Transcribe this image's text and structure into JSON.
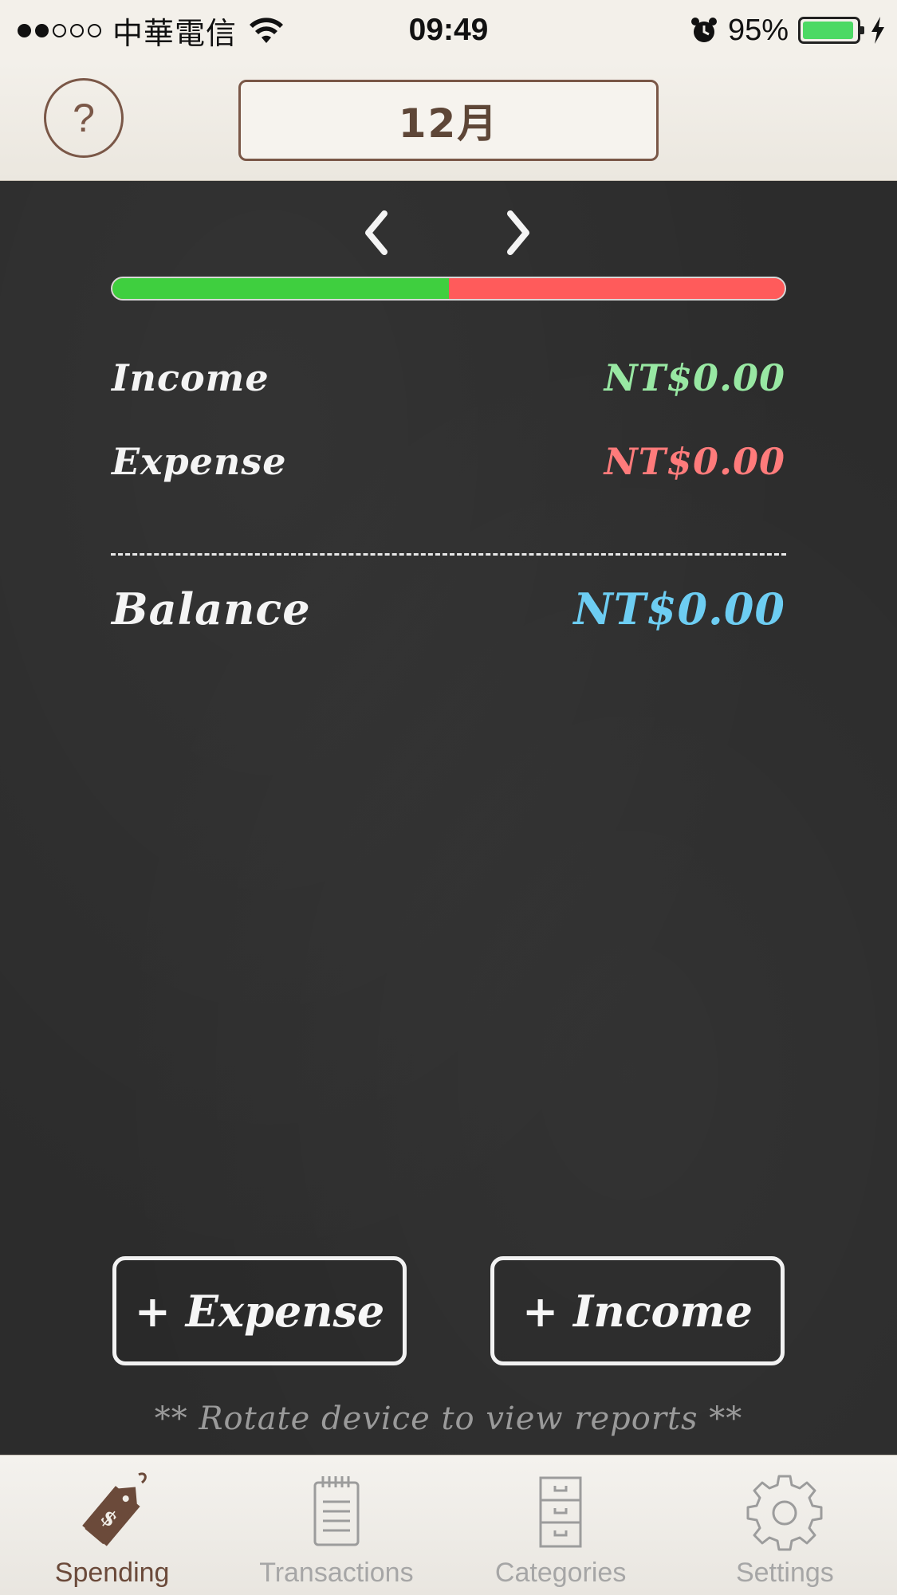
{
  "status_bar": {
    "carrier": "中華電信",
    "time": "09:49",
    "battery_percent": "95%",
    "battery_level": 0.95,
    "signal_bars_filled": 2,
    "signal_bars_total": 5
  },
  "header": {
    "help_label": "?",
    "month_label": "12月"
  },
  "summary": {
    "income_bar_fraction": 0.5,
    "income_label": "Income",
    "income_value": "NT$0.00",
    "expense_label": "Expense",
    "expense_value": "NT$0.00",
    "balance_label": "Balance",
    "balance_value": "NT$0.00"
  },
  "actions": {
    "add_expense_label": "+ Expense",
    "add_income_label": "+ Income"
  },
  "hint": "** Rotate device to view reports **",
  "tabs": [
    {
      "label": "Spending",
      "icon": "price-tag-icon",
      "active": true
    },
    {
      "label": "Transactions",
      "icon": "notepad-icon",
      "active": false
    },
    {
      "label": "Categories",
      "icon": "file-cabinet-icon",
      "active": false
    },
    {
      "label": "Settings",
      "icon": "gear-icon",
      "active": false
    }
  ],
  "colors": {
    "income": "#98e8a3",
    "expense": "#ff7b7b",
    "balance": "#6dcdf2",
    "accent_brown": "#7a5747"
  }
}
